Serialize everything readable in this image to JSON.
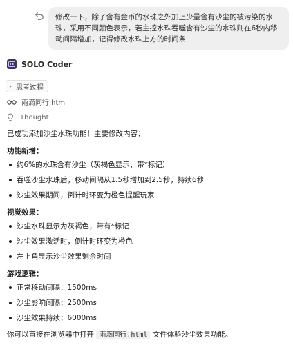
{
  "user_message": "修改一下，除了含有金币的水珠之外加上少量含有沙尘的被污染的水珠，采用不同颜色表示，若主控水珠吞噬含有沙尘的水珠则在6秒内移动间隔增加，记得修改水珠上方的时间条",
  "assistant": {
    "name": "SOLO Coder",
    "thinking_label": "思考过程",
    "file_name": "雨滴同行.html",
    "thought_label": "Thought",
    "intro": "已成功添加沙尘水珠功能！主要修改内容：",
    "sections": [
      {
        "title": "功能新增：",
        "items": [
          "约6%的水珠含有沙尘（灰褐色显示，带*标记）",
          "吞噬沙尘水珠后，移动间隔从1.5秒增加到2.5秒，持续6秒",
          "沙尘效果期间，倒计时环变为橙色提醒玩家"
        ]
      },
      {
        "title": "视觉效果：",
        "items": [
          "沙尘水珠显示为灰褐色，带有*标记",
          "沙尘效果激活时，倒计时环变为橙色",
          "左上角显示沙尘效果剩余时间"
        ]
      },
      {
        "title": "游戏逻辑：",
        "items": [
          "正常移动间隔：1500ms",
          "沙尘影响间隔：2500ms",
          "沙尘效果持续：6000ms"
        ]
      }
    ],
    "footer_before": "你可以直接在浏览器中打开 ",
    "footer_code": "雨滴同行.html",
    "footer_after": " 文件体验沙尘效果功能。"
  },
  "colors": {
    "bubble_bg": "#efefef",
    "logo_bg": "#3a3a58",
    "logo_accent": "#9b8cff"
  },
  "icons": [
    "undo-icon",
    "solo-coder-logo",
    "chevron-right-icon",
    "glasses-icon",
    "lightbulb-icon"
  ]
}
